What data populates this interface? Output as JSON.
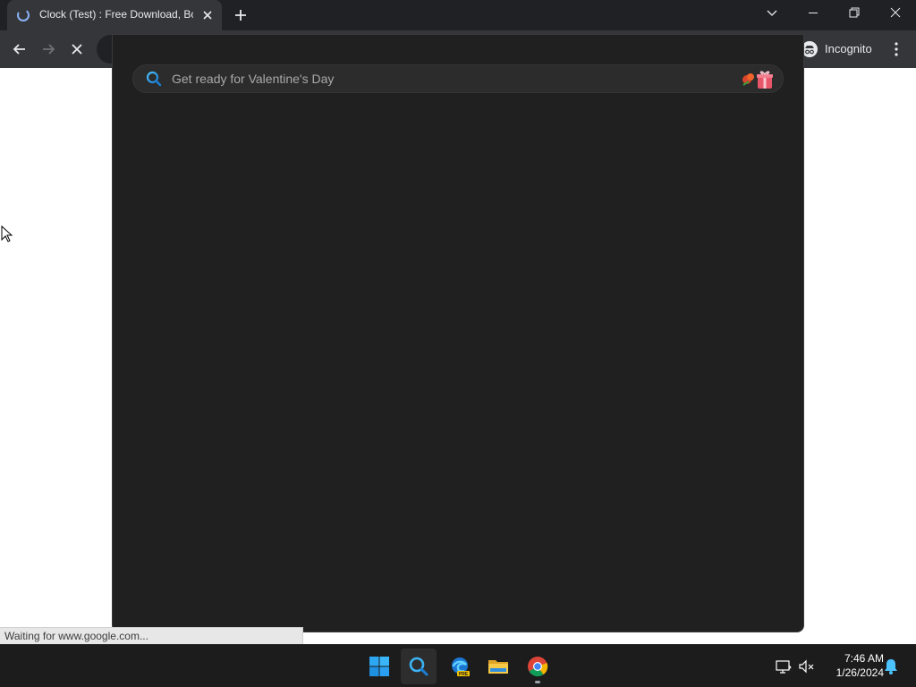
{
  "browser": {
    "tab": {
      "title": "Clock (Test) : Free Download, Bor"
    },
    "profile": {
      "label": "Incognito"
    }
  },
  "search_panel": {
    "placeholder": "Get ready for Valentine's Day"
  },
  "status_bar": {
    "text": "Waiting for www.google.com..."
  },
  "taskbar": {
    "time": "7:46 AM",
    "date": "1/26/2024",
    "apps": [
      "windows-start-icon",
      "search-icon",
      "edge-preview-icon",
      "file-explorer-icon",
      "chrome-icon"
    ]
  },
  "colors": {
    "titlebar": "#202124",
    "toolbar": "#35363a",
    "panel": "#202020",
    "taskbar": "#1c1c1c"
  }
}
